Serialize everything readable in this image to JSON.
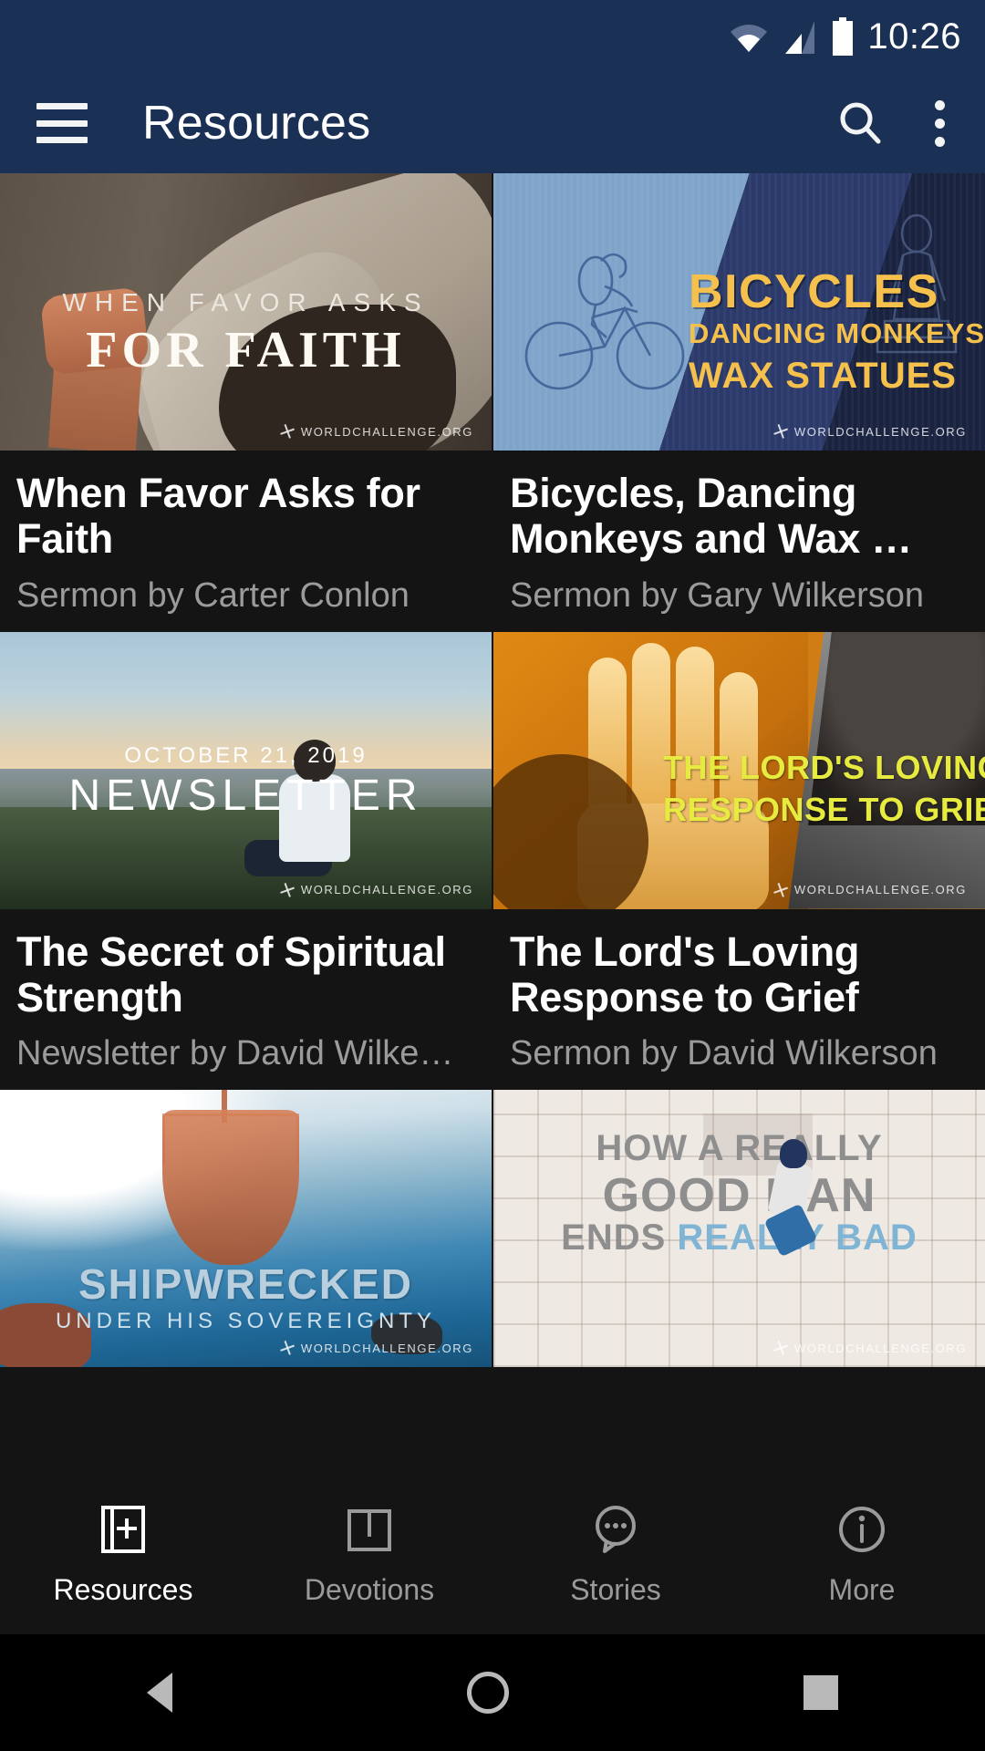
{
  "status_bar": {
    "time": "10:26",
    "icons": [
      "wifi-icon",
      "cellular-signal-icon",
      "battery-icon"
    ]
  },
  "app_bar": {
    "menu_icon": "hamburger-menu-icon",
    "title": "Resources",
    "search_icon": "search-icon",
    "overflow_icon": "overflow-menu-icon"
  },
  "colors": {
    "app_bar": "#1b3055",
    "page_background": "#141414",
    "title_text": "#ffffff",
    "byline_text": "#9b9b9b",
    "nav_active": "#ffffff",
    "nav_inactive": "#9a9a9a"
  },
  "watermark": "WORLDCHALLENGE.ORG",
  "grid": {
    "cards": [
      {
        "title": "When Favor Asks for Faith",
        "byline": "Sermon by Carter Conlon",
        "thumbnail": {
          "name": "when-favor-asks-for-faith-thumbnail",
          "line1": "WHEN FAVOR ASKS",
          "line2": "FOR FAITH"
        }
      },
      {
        "title": "Bicycles, Dancing Monkeys and Wax …",
        "byline": "Sermon by Gary Wilkerson",
        "thumbnail": {
          "name": "bicycles-dancing-monkeys-thumbnail",
          "line1": "BICYCLES",
          "line2": "DANCING MONKEYS",
          "line3": "WAX STATUES"
        }
      },
      {
        "title": "The Secret of Spiritual Strength",
        "byline": "Newsletter by David Wilke…",
        "thumbnail": {
          "name": "newsletter-thumbnail",
          "date": "OCTOBER 21, 2019",
          "line1": "NEWSLETTER"
        }
      },
      {
        "title": "The Lord's Loving Response to Grief",
        "byline": "Sermon by David Wilkerson",
        "thumbnail": {
          "name": "lords-loving-response-to-grief-thumbnail",
          "line1": "THE LORD'S LOVING",
          "line2": "RESPONSE TO GRIEF"
        }
      },
      {
        "title": "",
        "byline": "",
        "thumbnail": {
          "name": "shipwrecked-thumbnail",
          "line1": "SHIPWRECKED",
          "line2": "UNDER HIS SOVEREIGNTY"
        }
      },
      {
        "title": "",
        "byline": "",
        "thumbnail": {
          "name": "how-a-really-good-man-ends-really-bad-thumbnail",
          "line1": "HOW A REALLY",
          "line2": "GOOD MAN",
          "line3a": "ENDS ",
          "line3b": "REALLY BAD"
        }
      }
    ]
  },
  "bottom_nav": {
    "items": [
      {
        "label": "Resources",
        "icon": "bible-book-icon",
        "active": true
      },
      {
        "label": "Devotions",
        "icon": "open-book-icon",
        "active": false
      },
      {
        "label": "Stories",
        "icon": "chat-bubble-icon",
        "active": false
      },
      {
        "label": "More",
        "icon": "info-circle-icon",
        "active": false
      }
    ]
  },
  "system_nav": {
    "back": "back-triangle-icon",
    "home": "home-circle-icon",
    "recents": "recents-square-icon"
  }
}
